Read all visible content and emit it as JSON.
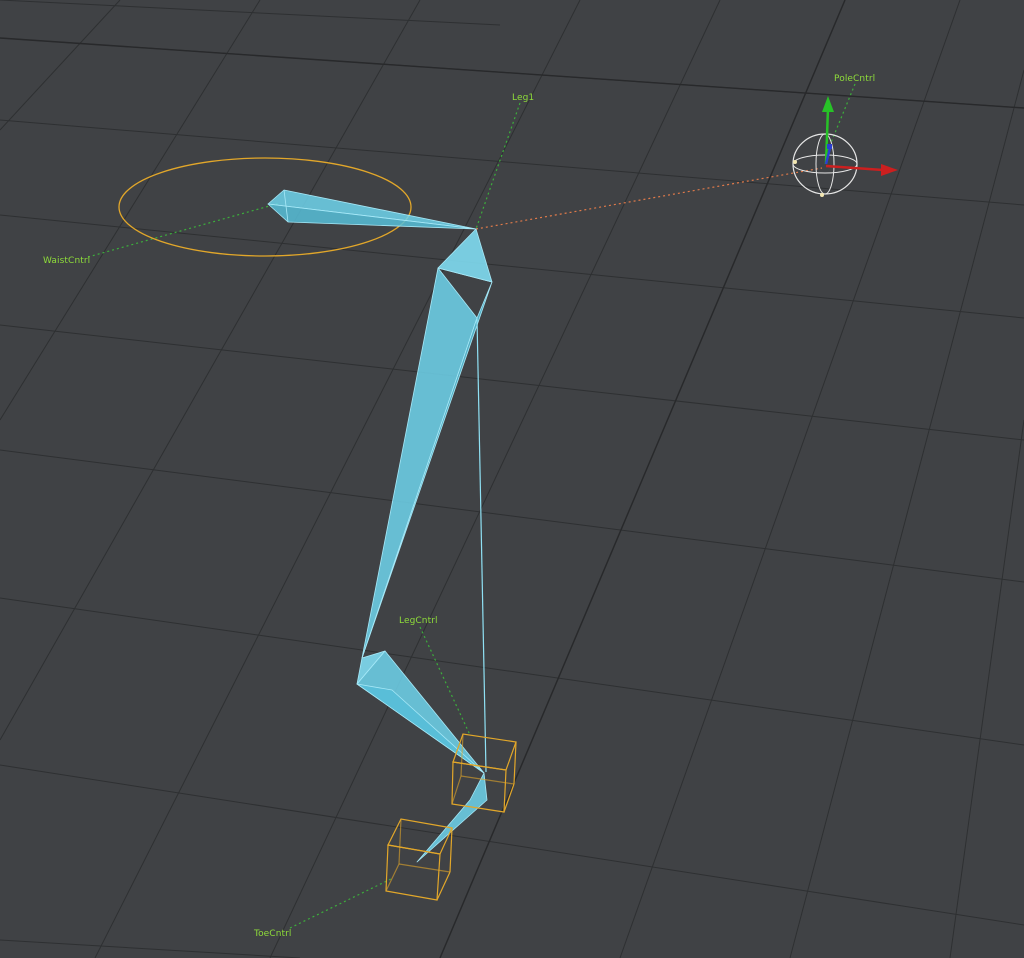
{
  "viewport": {
    "labels": {
      "leg": "Leg1",
      "pole": "PoleCntrl",
      "waist": "WaistCntrl",
      "leg_control": "LegCntrl",
      "toe": "ToeCntrl"
    }
  },
  "colors": {
    "background": "#404245",
    "grid": "#2f3133",
    "grid_major": "#2a2c2e",
    "bone_fill": "#6fd3ec",
    "bone_edge": "#9fe6f6",
    "control_yellow": "#e2a72a",
    "label_green": "#8edc3a",
    "dotted_green": "#3cae3c",
    "dotted_orange": "#e07a4a",
    "axis_x": "#cc1f1f",
    "axis_y": "#27c227",
    "axis_z": "#2b3fd0"
  },
  "icons": {
    "pole_gizmo": "translate-gizmo-icon"
  }
}
